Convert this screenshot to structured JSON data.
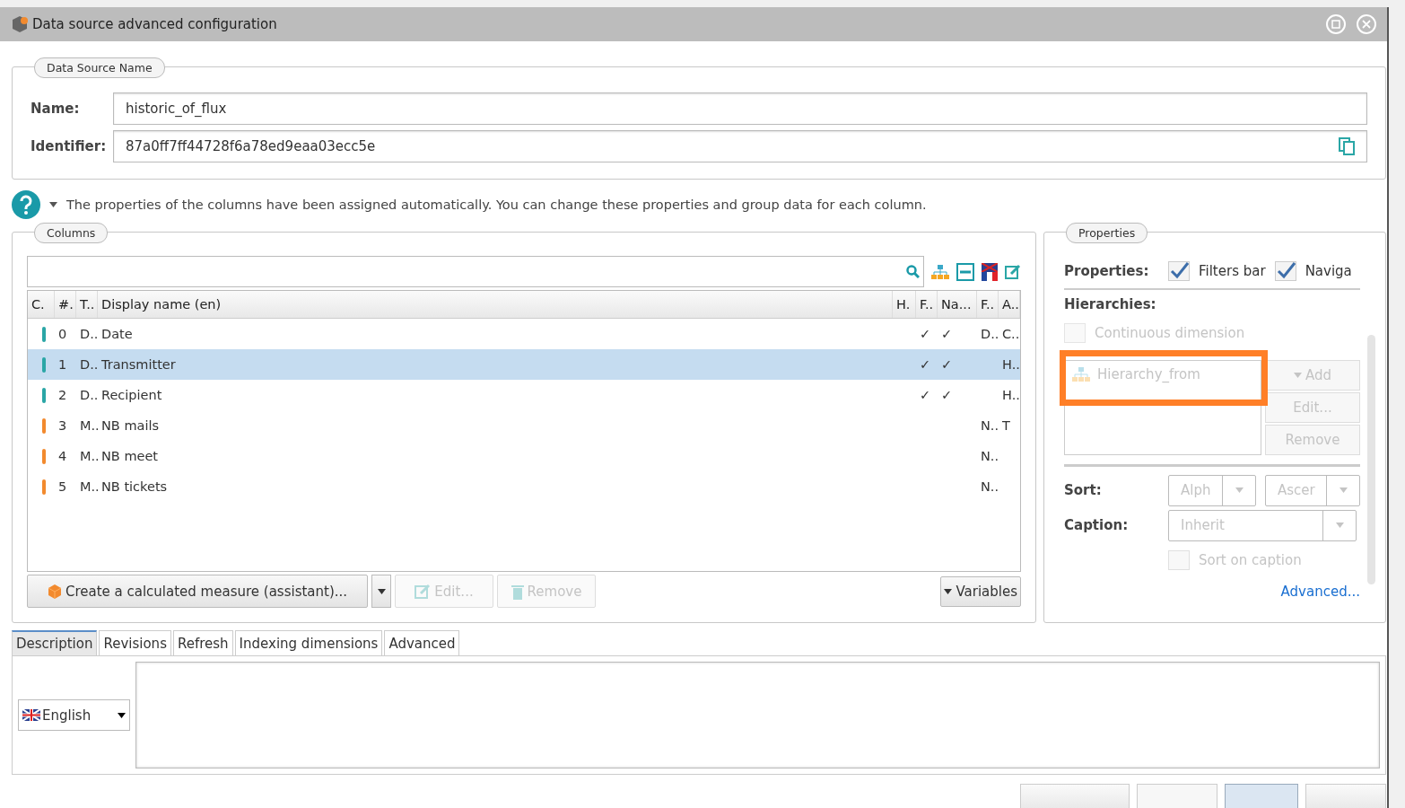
{
  "window": {
    "title": "Data source advanced configuration"
  },
  "name_section": {
    "legend": "Data Source Name",
    "fields": [
      {
        "label": "Name:",
        "value": "historic_of_flux",
        "kind": "text"
      },
      {
        "label": "Identifier:",
        "value": "87a0ff7ff44728f6a78ed9eaa03ecc5e",
        "kind": "copy"
      }
    ]
  },
  "info": {
    "text": "The properties of the columns have been assigned automatically. You can change these properties and group data for each column."
  },
  "columns": {
    "legend": "Columns",
    "headers": [
      "C.",
      "#.",
      "T..",
      "Display name (en)",
      "H.",
      "F..",
      "Na...",
      "F..",
      "A.."
    ],
    "rows": [
      {
        "color": "#2aa6a6",
        "index": "0",
        "type": "D..",
        "name": "Date",
        "f": "✓",
        "na": "✓",
        "f2": "D..",
        "a": "C..",
        "selected": false
      },
      {
        "color": "#2aa6a6",
        "index": "1",
        "type": "D..",
        "name": "Transmitter",
        "f": "✓",
        "na": "✓",
        "a": "H..",
        "selected": true
      },
      {
        "color": "#2aa6a6",
        "index": "2",
        "type": "D..",
        "name": "Recipient",
        "f": "✓",
        "na": "✓",
        "a": "H..",
        "selected": false
      },
      {
        "color": "#f28a2e",
        "index": "3",
        "type": "M..",
        "name": "NB mails",
        "f2": "N..",
        "a": "T",
        "selected": false
      },
      {
        "color": "#f28a2e",
        "index": "4",
        "type": "M..",
        "name": "NB meet",
        "f2": "N..",
        "selected": false
      },
      {
        "color": "#f28a2e",
        "index": "5",
        "type": "M..",
        "name": "NB tickets",
        "f2": "N..",
        "selected": false
      }
    ],
    "buttons": [
      {
        "kind": "create",
        "label": "Create a calculated measure (assistant)...",
        "disabled": false
      },
      {
        "kind": "edit",
        "label": "Edit...",
        "disabled": true
      },
      {
        "kind": "remove",
        "label": "Remove",
        "disabled": true
      }
    ],
    "variables": {
      "label": "Variables"
    }
  },
  "properties": {
    "legend": "Properties",
    "label": "Properties:",
    "checks": [
      {
        "label": "Filters bar",
        "checked": true
      },
      {
        "label": "Naviga",
        "checked": true
      }
    ],
    "hierarchies_label": "Hierarchies:",
    "continuous": {
      "label": "Continuous dimension",
      "checked": false
    },
    "hierarchies": [
      {
        "name": "Hierarchy_from"
      }
    ],
    "hierarchy_buttons": [
      {
        "label": "Add",
        "kind": "dropdown"
      },
      {
        "label": "Edit...",
        "kind": "plain"
      },
      {
        "label": "Remove",
        "kind": "plain"
      }
    ],
    "sort_label": "Sort:",
    "sort": [
      {
        "value": "Alph",
        "disabled": true
      },
      {
        "value": "Ascer",
        "disabled": true
      }
    ],
    "caption_label": "Caption:",
    "caption": {
      "value": "Inherit",
      "disabled": true
    },
    "sort_on_caption": {
      "label": "Sort on caption",
      "checked": false
    },
    "advanced_link": "Advanced..."
  },
  "tabs": [
    {
      "label": "Description",
      "selected": true
    },
    {
      "label": "Revisions",
      "selected": false
    },
    {
      "label": "Refresh",
      "selected": false
    },
    {
      "label": "Indexing dimensions",
      "selected": false
    },
    {
      "label": "Advanced",
      "selected": false
    }
  ],
  "description": {
    "language": "English"
  },
  "footer_buttons": [
    {
      "kind": "default"
    },
    {
      "kind": "disabled"
    },
    {
      "kind": "primary"
    },
    {
      "kind": "default"
    }
  ]
}
